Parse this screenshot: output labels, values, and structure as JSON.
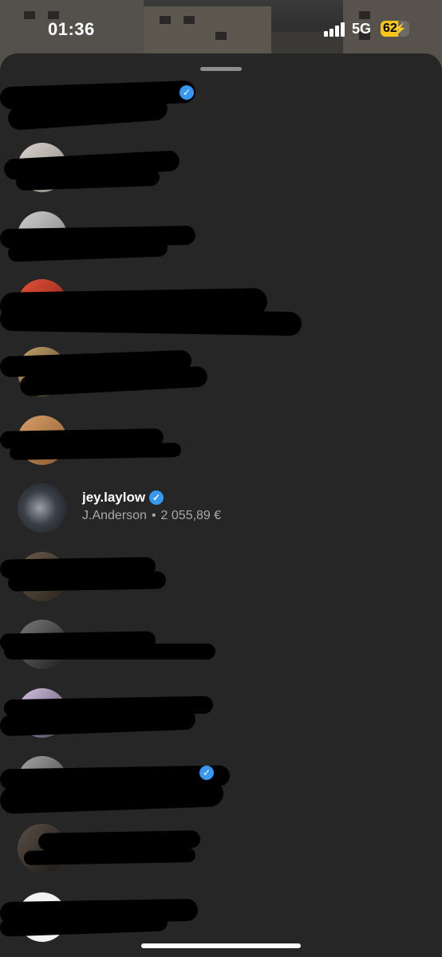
{
  "status_bar": {
    "time": "01:36",
    "network": "5G",
    "battery_level": "62",
    "battery_charging_icon": "bolt-icon",
    "signal_icon": "signal-bars-icon"
  },
  "list": {
    "highlighted_row": {
      "username": "jey.laylow",
      "verified": true,
      "verified_icon": "verified-badge-icon",
      "display_name": "J.Anderson",
      "separator": "•",
      "amount": "2 055,89 €"
    },
    "redacted_rows_count_above": 6,
    "redacted_rows_count_below": 6
  },
  "colors": {
    "sheet_background": "#262626",
    "verified_badge": "#3897f0",
    "subtitle_text": "#a8a8a8",
    "battery_fill": "#f5c518"
  }
}
